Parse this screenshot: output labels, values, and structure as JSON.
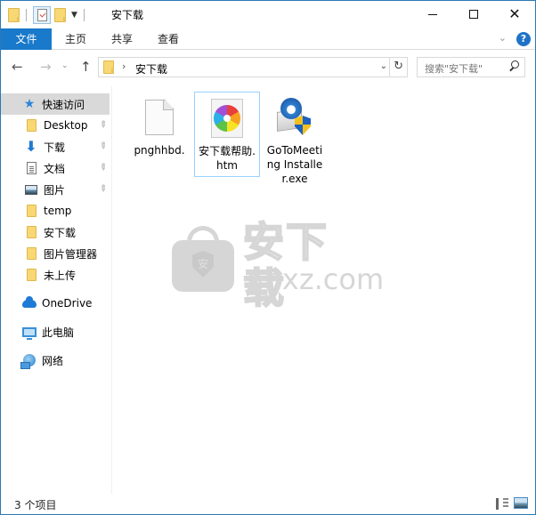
{
  "window": {
    "title": "安下载",
    "controls": {
      "minimize": "minimize",
      "maximize": "maximize",
      "close": "close"
    }
  },
  "quick_access_toolbar": {
    "icons": [
      "folder-icon",
      "properties-icon",
      "new-folder-icon",
      "customize-dropdown-icon"
    ]
  },
  "ribbon": {
    "tabs": [
      {
        "label": "文件",
        "active": true
      },
      {
        "label": "主页"
      },
      {
        "label": "共享"
      },
      {
        "label": "查看"
      }
    ],
    "help_label": "?",
    "accent_color": "#1979ca"
  },
  "navbar": {
    "address": {
      "separator": "›",
      "path_segment": "安下载"
    },
    "refresh_glyph": "↻",
    "search": {
      "placeholder": "搜索\"安下载\""
    }
  },
  "sidebar": {
    "items": [
      {
        "label": "快速访问",
        "icon": "star-icon",
        "selected": true
      },
      {
        "label": "Desktop",
        "icon": "folder-icon",
        "pinned": true
      },
      {
        "label": "下载",
        "icon": "download-arrow-icon",
        "pinned": true
      },
      {
        "label": "文档",
        "icon": "document-icon",
        "pinned": true
      },
      {
        "label": "图片",
        "icon": "picture-icon",
        "pinned": true
      },
      {
        "label": "temp",
        "icon": "folder-icon"
      },
      {
        "label": "安下载",
        "icon": "folder-icon"
      },
      {
        "label": "图片管理器",
        "icon": "folder-icon"
      },
      {
        "label": "未上传",
        "icon": "folder-icon"
      },
      {
        "label": "OneDrive",
        "icon": "onedrive-cloud-icon"
      },
      {
        "label": "此电脑",
        "icon": "computer-icon"
      },
      {
        "label": "网络",
        "icon": "network-icon"
      }
    ],
    "pin_glyph": "📌"
  },
  "files": [
    {
      "name": "pnghhbd.",
      "icon": "blank-file-icon"
    },
    {
      "name": "安下载帮助.htm",
      "icon": "htm-file-icon",
      "selected": true
    },
    {
      "name": "GoToMeeting Installer.exe",
      "icon": "installer-exe-icon"
    }
  ],
  "watermark": {
    "cn_text": "安下载",
    "en_text": "anxz.com",
    "badge_char": "安"
  },
  "statusbar": {
    "item_count": "3 个项目",
    "views": [
      "details-view",
      "large-icons-view"
    ]
  }
}
